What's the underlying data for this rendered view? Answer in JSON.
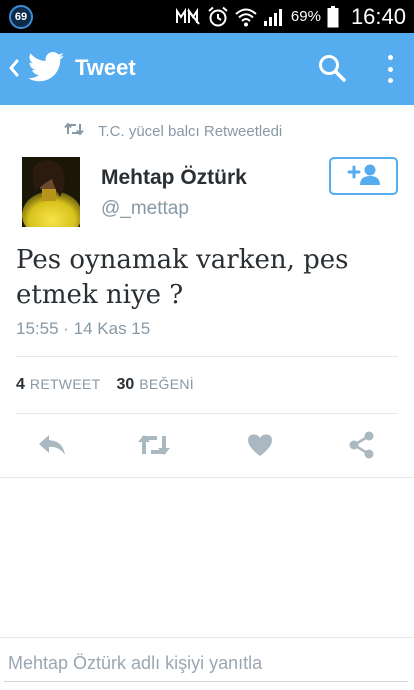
{
  "status_bar": {
    "notification_count": "69",
    "battery_percent": "69%",
    "time": "16:40",
    "icons": [
      "notification-count-icon",
      "mute-icon",
      "alarm-icon",
      "wifi-icon",
      "signal-icon",
      "battery-icon"
    ]
  },
  "app_bar": {
    "title": "Tweet",
    "back_icon": "chevron-left-icon",
    "logo_icon": "twitter-bird-icon",
    "search_icon": "search-icon",
    "menu_icon": "overflow-menu-icon",
    "color": "#55acee"
  },
  "tweet": {
    "retweet_context": "T.C. yücel balcı Retweetledi",
    "author": {
      "name": "Mehtap Öztürk",
      "handle": "@_mettap"
    },
    "text_lines": [
      "Pes oynamak varken, pes",
      "etmek niye ?"
    ],
    "timestamp": "15:55 · 14 Kas 15",
    "stats": {
      "retweet_count": "4",
      "retweet_label": "RETWEET",
      "like_count": "30",
      "like_label": "BEĞENİ"
    },
    "actions": [
      "reply-icon",
      "retweet-icon",
      "heart-icon",
      "share-icon"
    ]
  },
  "reply": {
    "placeholder": "Mehtap Öztürk adlı kişiyi yanıtla",
    "value": ""
  },
  "colors": {
    "accent": "#55acee",
    "muted_text": "#8899a6",
    "action_icons": "#aab8c2"
  }
}
